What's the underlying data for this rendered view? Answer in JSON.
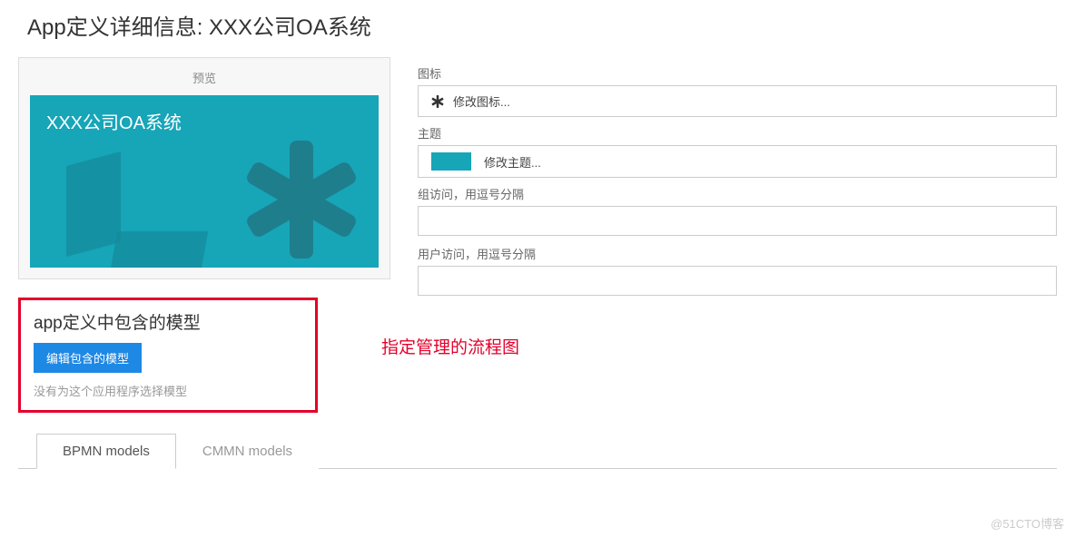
{
  "page_title": "App定义详细信息: XXX公司OA系统",
  "preview": {
    "label": "预览",
    "card_title": "XXX公司OA系统",
    "theme_color": "#17a5b8"
  },
  "form": {
    "icon_label": "图标",
    "icon_action": "修改图标...",
    "theme_label": "主题",
    "theme_action": "修改主题...",
    "group_access_label": "组访问，用逗号分隔",
    "group_access_value": "",
    "user_access_label": "用户访问，用逗号分隔",
    "user_access_value": ""
  },
  "models": {
    "heading": "app定义中包含的模型",
    "edit_button": "编辑包含的模型",
    "empty_text": "没有为这个应用程序选择模型",
    "annotation": "指定管理的流程图"
  },
  "tabs": {
    "bpmn": "BPMN models",
    "cmmn": "CMMN models",
    "active": "bpmn"
  },
  "watermark": "@51CTO博客"
}
